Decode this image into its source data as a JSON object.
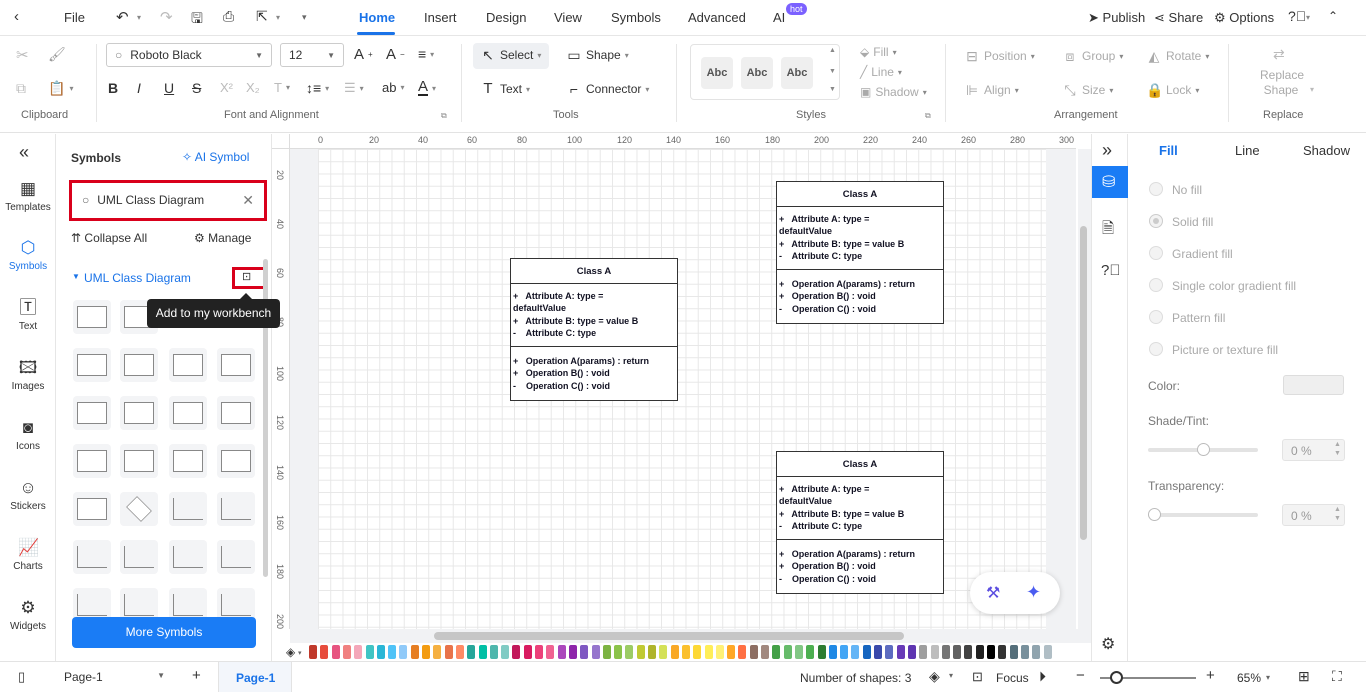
{
  "menubar": {
    "file": "File",
    "tabs": [
      "Home",
      "Insert",
      "Design",
      "View",
      "Symbols",
      "Advanced",
      "AI"
    ],
    "ai_badge": "hot",
    "publish": "Publish",
    "share": "Share",
    "options": "Options"
  },
  "ribbon": {
    "font_name": "Roboto Black",
    "font_size": "12",
    "select": "Select",
    "shape": "Shape",
    "text": "Text",
    "connector": "Connector",
    "style_abc": "Abc",
    "fill": "Fill",
    "line": "Line",
    "shadow": "Shadow",
    "position": "Position",
    "group": "Group",
    "rotate": "Rotate",
    "align": "Align",
    "size": "Size",
    "lock": "Lock",
    "replace_shape_1": "Replace",
    "replace_shape_2": "Shape",
    "groups": {
      "clipboard": "Clipboard",
      "font_alignment": "Font and Alignment",
      "tools": "Tools",
      "styles": "Styles",
      "arrangement": "Arrangement",
      "replace": "Replace"
    }
  },
  "leftnav": {
    "items": [
      "Templates",
      "Symbols",
      "Text",
      "Images",
      "Icons",
      "Stickers",
      "Charts",
      "Widgets"
    ]
  },
  "symbols": {
    "title": "Symbols",
    "ai_symbol": "AI Symbol",
    "search_value": "UML Class Diagram",
    "collapse_all": "Collapse All",
    "manage": "Manage",
    "category": "UML Class Diagram",
    "tooltip": "Add to my workbench",
    "more_symbols": "More Symbols"
  },
  "rulers": {
    "h_ticks": [
      "0",
      "20",
      "40",
      "60",
      "80",
      "100",
      "120",
      "140",
      "160",
      "180",
      "200",
      "220",
      "240",
      "260",
      "280",
      "300"
    ],
    "v_ticks": [
      "20",
      "40",
      "60",
      "80",
      "100",
      "120",
      "140",
      "160",
      "180",
      "200"
    ]
  },
  "uml_boxes": [
    {
      "name": "Class A",
      "attrs": [
        "+   Attribute A: type =",
        "defaultValue",
        "+   Attribute B: type = value B",
        "-    Attribute C: type"
      ],
      "ops": [
        "+   Operation A(params) : return",
        "+   Operation B() : void",
        "-    Operation C() : void"
      ]
    },
    {
      "name": "Class A",
      "attrs": [
        "+   Attribute A: type =",
        "defaultValue",
        "+   Attribute B: type = value B",
        "-    Attribute C: type"
      ],
      "ops": [
        "+   Operation A(params) : return",
        "+   Operation B() : void",
        "-    Operation C() : void"
      ]
    },
    {
      "name": "Class A",
      "attrs": [
        "+   Attribute A: type =",
        "defaultValue",
        "+   Attribute B: type = value B",
        "-    Attribute C: type"
      ],
      "ops": [
        "+   Operation A(params) : return",
        "+   Operation B() : void",
        "-    Operation C() : void"
      ]
    }
  ],
  "rightpanel": {
    "tabs": [
      "Fill",
      "Line",
      "Shadow"
    ],
    "fill_options": [
      "No fill",
      "Solid fill",
      "Gradient fill",
      "Single color gradient fill",
      "Pattern fill",
      "Picture or texture fill"
    ],
    "color_label": "Color:",
    "shade_label": "Shade/Tint:",
    "shade_value": "0 %",
    "transparency_label": "Transparency:",
    "transparency_value": "0 %"
  },
  "statusbar": {
    "page_select": "Page-1",
    "page_tab": "Page-1",
    "shapes_count": "Number of shapes: 3",
    "focus": "Focus",
    "zoom": "65%"
  },
  "colors": {
    "accent": "#1a73e8",
    "highlight_red": "#d9001b",
    "primary_button": "#1a7cf5"
  },
  "palette": [
    "#c0392b",
    "#e74c3c",
    "#e75480",
    "#f08080",
    "#f4a7b9",
    "#40c4c4",
    "#29b6d6",
    "#4fc3f7",
    "#90caf9",
    "#e67e22",
    "#f39c12",
    "#f5b041",
    "#e8734a",
    "#ff8a65",
    "#26a69a",
    "#00bfa5",
    "#4db6ac",
    "#80cbc4",
    "#c2185b",
    "#d81b60",
    "#ec407a",
    "#f06292",
    "#ab47bc",
    "#8e24aa",
    "#7e57c2",
    "#9575cd",
    "#7cb342",
    "#8bc34a",
    "#9ccc65",
    "#c0ca33",
    "#afb42b",
    "#d4e157",
    "#f9a825",
    "#fbc02d",
    "#fdd835",
    "#ffee58",
    "#fff176",
    "#ffa726",
    "#ff7043",
    "#8d6e63",
    "#a1887f",
    "#43a047",
    "#66bb6a",
    "#81c784",
    "#4caf50",
    "#2e7d32",
    "#1e88e5",
    "#42a5f5",
    "#64b5f6",
    "#1565c0",
    "#3949ab",
    "#5c6bc0",
    "#673ab7",
    "#5e35b1",
    "#9e9e9e",
    "#bdbdbd",
    "#757575",
    "#616161",
    "#424242",
    "#212121",
    "#000000",
    "#333333",
    "#546e7a",
    "#78909c",
    "#90a4ae",
    "#b0bec5"
  ]
}
